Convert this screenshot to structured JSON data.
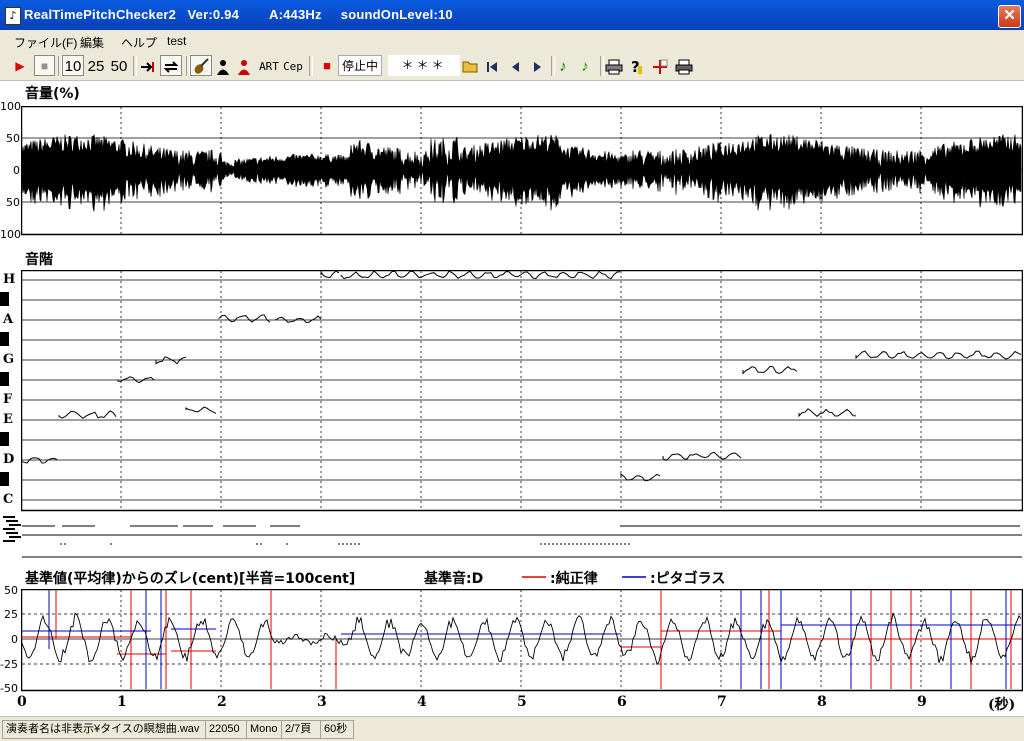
{
  "window": {
    "title": "RealTimePitchChecker2   Ver:0.94        A:443Hz     soundOnLevel:10",
    "close": "✕",
    "icon": "♪"
  },
  "menu": [
    "ファイル(F)",
    "編集",
    "ヘルプ",
    "test"
  ],
  "toolbar": {
    "play": "▶",
    "stop": "■",
    "speed_10": "10",
    "speed_25": "25",
    "speed_50": "50",
    "art": "ART",
    "cep": "Cep",
    "rec_indicator": "■",
    "status": "停止中",
    "stars": "＊＊＊"
  },
  "volume_panel": {
    "title": "音量(%)",
    "y_labels": [
      "100",
      "50",
      "0",
      "50",
      "100"
    ]
  },
  "scale_panel": {
    "title": "音階",
    "notes": [
      "H",
      "A",
      "G",
      "F",
      "E",
      "D",
      "C"
    ]
  },
  "deviation_panel": {
    "title": "基準値(平均律)からのズレ(cent)[半音=100cent]",
    "base_note": "基準音:D",
    "legend_just": ":純正律",
    "legend_pyth": ":ピタゴラス",
    "y_labels": [
      "50",
      "25",
      "0",
      "-25",
      "-50"
    ],
    "x_labels": [
      "0",
      "1",
      "2",
      "3",
      "4",
      "5",
      "6",
      "7",
      "8",
      "9"
    ],
    "x_unit": "(秒)"
  },
  "colors": {
    "just": "#e00000",
    "pythagorean": "#0000c0",
    "trace": "#000000"
  },
  "statusbar": {
    "file": "演奏者名は非表示¥タイスの瞑想曲.wav",
    "rate": "22050",
    "channels": "Mono",
    "page": "2/7頁",
    "duration": "60秒"
  }
}
